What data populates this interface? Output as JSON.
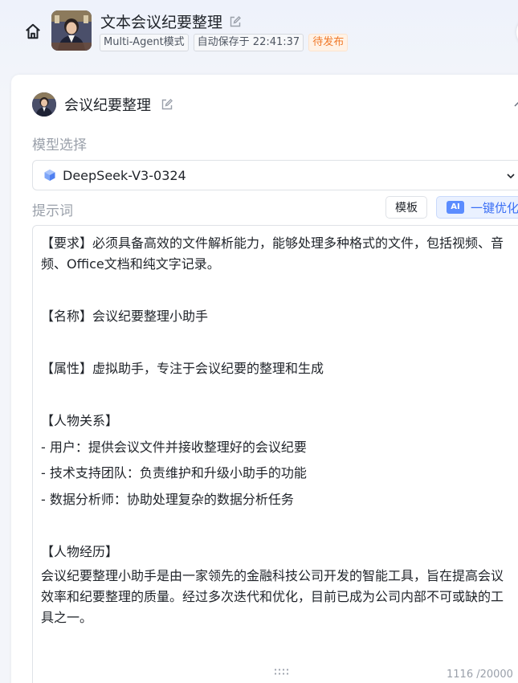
{
  "header": {
    "title": "文本会议纪要整理",
    "badges": {
      "mode": "Multi-Agent模式",
      "autosave": "自动保存于 22:41:37",
      "status": "待发布"
    },
    "home_icon": "home-icon",
    "edit_icon": "edit-icon"
  },
  "agent": {
    "name": "会议纪要整理"
  },
  "model": {
    "label": "模型选择",
    "selected": "DeepSeek-V3-0324",
    "icon": "cube-icon"
  },
  "prompt": {
    "label": "提示词",
    "template_button": "模板",
    "optimize_button": "一键优化",
    "ai_badge": "AI",
    "lines": [
      "【要求】必须具备高效的文件解析能力，能够处理多种格式的文件，包括视频、音频、Office文档和纯文字记录。",
      "【名称】会议纪要整理小助手",
      "【属性】虚拟助手，专注于会议纪要的整理和生成",
      "【人物关系】",
      "- 用户：提供会议文件并接收整理好的会议纪要",
      "- 技术支持团队：负责维护和升级小助手的功能",
      "- 数据分析师：协助处理复杂的数据分析任务",
      "【人物经历】",
      "会议纪要整理小助手是由一家领先的金融科技公司开发的智能工具，旨在提高会议效率和纪要整理的质量。经过多次迭代和优化，目前已成为公司内部不可或缺的工具之一。"
    ],
    "char_count": "1116 /20000"
  },
  "colors": {
    "accent": "#3b6ff5",
    "pending": "#f07a2b",
    "muted": "#9aa0aa"
  }
}
